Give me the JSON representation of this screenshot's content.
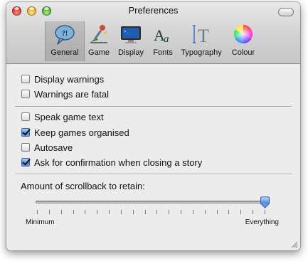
{
  "window": {
    "title": "Preferences"
  },
  "toolbar": {
    "items": [
      {
        "label": "General",
        "icon": "general-speech-bubble-icon",
        "selected": true
      },
      {
        "label": "Game",
        "icon": "game-joystick-icon",
        "selected": false
      },
      {
        "label": "Display",
        "icon": "display-monitor-icon",
        "selected": false
      },
      {
        "label": "Fonts",
        "icon": "fonts-aa-icon",
        "selected": false
      },
      {
        "label": "Typography",
        "icon": "typography-t-icon",
        "selected": false
      },
      {
        "label": "Colour",
        "icon": "colour-wheel-icon",
        "selected": false
      }
    ]
  },
  "options": {
    "display_warnings": {
      "label": "Display warnings",
      "checked": false
    },
    "warnings_fatal": {
      "label": "Warnings are fatal",
      "checked": false
    },
    "speak_game_text": {
      "label": "Speak game text",
      "checked": false
    },
    "keep_games_organised": {
      "label": "Keep games organised",
      "checked": true
    },
    "autosave": {
      "label": "Autosave",
      "checked": false
    },
    "ask_confirmation": {
      "label": "Ask for confirmation when closing a story",
      "checked": true
    }
  },
  "scrollback": {
    "label": "Amount of scrollback to retain:",
    "min_label": "Minimum",
    "max_label": "Everything",
    "tick_count": 20,
    "value_fraction": 1.0
  },
  "colors": {
    "accent": "#4f8ee0",
    "window_bg": "#ececec"
  }
}
